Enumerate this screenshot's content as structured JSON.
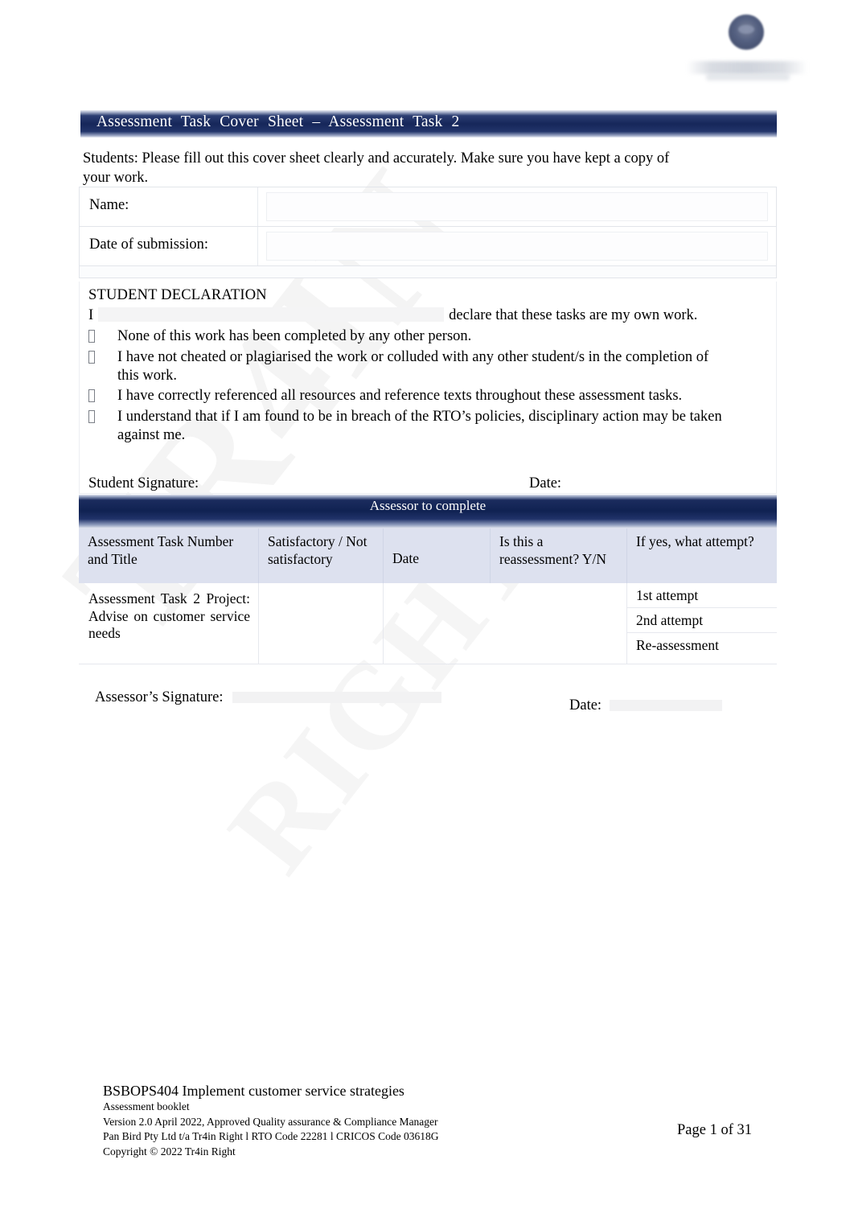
{
  "document": {
    "banner_title": "Assessment Task Cover Sheet – Assessment Task 2",
    "intro": "Students: Please fill out this cover sheet clearly and accurately. Make sure you have kept a copy of your work."
  },
  "logo": {
    "name": "tr4in-right-logo"
  },
  "watermark": {
    "line1": "TR4IN",
    "line2": "RIGHT"
  },
  "student_fields": [
    {
      "label": "Name:",
      "value": ""
    },
    {
      "label": "Date of submission:",
      "value": ""
    }
  ],
  "declaration": {
    "heading": "STUDENT DECLARATION",
    "lead_prefix": "I",
    "lead_suffix": "declare that these tasks are my own work.",
    "items": [
      "None of this work has been completed by any other person.",
      "I have not cheated or plagiarised the work or colluded with any other student/s in the completion of this work.",
      "I have correctly referenced all resources and reference texts throughout these assessment tasks.",
      "I understand that if I am found to be in breach of the RTO’s policies, disciplinary action may be taken against me."
    ],
    "signature_label": "Student Signature:",
    "date_label": "Date:"
  },
  "assessor": {
    "banner": "Assessor to complete",
    "columns": [
      "Assessment Task Number and Title",
      "Satisfactory / Not satisfactory",
      "Date",
      "Is this a reassessment? Y/N",
      "If yes, what attempt?"
    ],
    "row": {
      "task": "Assessment Task 2 Project: Advise on customer service needs",
      "satisfactory": "",
      "date": "",
      "reassessment": "",
      "attempts": [
        "1st attempt",
        "2nd attempt",
        "Re-assessment"
      ]
    },
    "signature_label": "Assessor’s Signature:",
    "date_label": "Date:"
  },
  "footer": {
    "title": "BSBOPS404 Implement customer service strategies",
    "line1": "Assessment booklet",
    "line2": "Version 2.0 April 2022, Approved Quality assurance & Compliance Manager",
    "line3": "Pan Bird Pty Ltd t/a Tr4in Right l RTO Code 22281 l CRICOS Code 03618G",
    "line4": "Copyright © 2022 Tr4in Right",
    "page": "Page 1 of 31"
  },
  "colors": {
    "banner_dark": "#16275a",
    "header_row": "#dde1ef"
  }
}
